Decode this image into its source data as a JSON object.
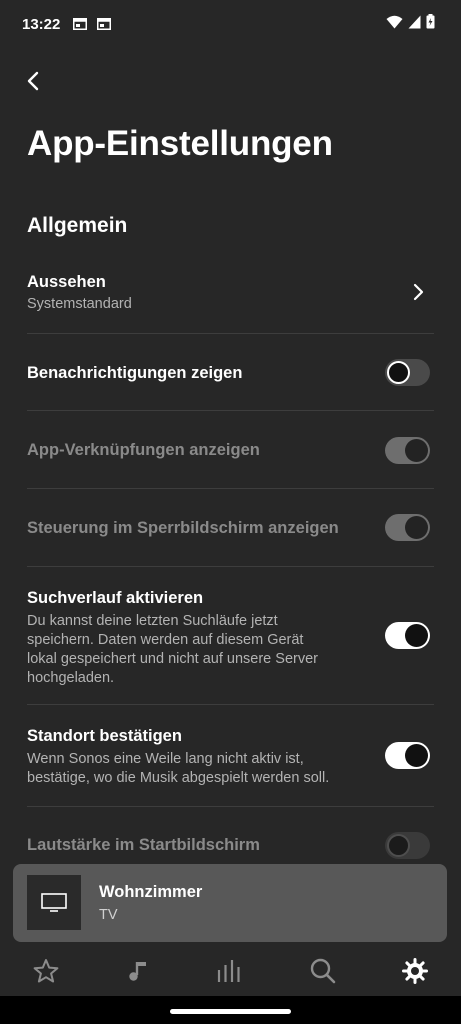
{
  "status_bar": {
    "time": "13:22",
    "notification_icons": [
      "app-notification-icon",
      "app-notification-icon"
    ],
    "system_icons": [
      "wifi-icon",
      "signal-icon",
      "battery-charging-icon"
    ]
  },
  "header": {
    "back_icon": "chevron-left-icon",
    "title": "App-Einstellungen"
  },
  "section": {
    "title": "Allgemein"
  },
  "settings": {
    "appearance": {
      "title": "Aussehen",
      "value": "Systemstandard",
      "icon": "chevron-right-icon"
    },
    "notifications": {
      "title": "Benachrichtigungen zeigen",
      "state": "off",
      "enabled": true
    },
    "app_shortcuts": {
      "title": "App-Verknüpfungen anzeigen",
      "state": "on",
      "enabled": false
    },
    "lockscreen_controls": {
      "title": "Steuerung im Sperrbildschirm anzeigen",
      "state": "on",
      "enabled": false
    },
    "search_history": {
      "title": "Suchverlauf aktivieren",
      "description_lines": [
        "Du kannst deine letzten Suchläufe jetzt",
        "speichern. Daten werden auf diesem Gerät",
        "lokal gespeichert und nicht auf unsere Server",
        "hochgeladen."
      ],
      "state": "on",
      "enabled": true
    },
    "confirm_location": {
      "title": "Standort bestätigen",
      "description_lines": [
        "Wenn Sonos eine Weile lang nicht aktiv ist,",
        "bestätige, wo die Musik abgespielt werden soll."
      ],
      "state": "on",
      "enabled": true
    },
    "homescreen_volume": {
      "title": "Lautstärke im Startbildschirm",
      "state": "off",
      "enabled": false
    }
  },
  "now_playing": {
    "room": "Wohnzimmer",
    "source": "TV",
    "art_icon": "tv-icon"
  },
  "tab_bar": {
    "tabs": [
      {
        "name": "favorites",
        "icon": "star-icon",
        "active": false
      },
      {
        "name": "music",
        "icon": "music-note-icon",
        "active": false
      },
      {
        "name": "rooms",
        "icon": "equalizer-icon",
        "active": false
      },
      {
        "name": "search",
        "icon": "search-icon",
        "active": false
      },
      {
        "name": "settings",
        "icon": "gear-icon",
        "active": true
      }
    ]
  },
  "colors": {
    "background": "#272727",
    "now_playing_bar": "#585858",
    "text_primary": "#ffffff",
    "text_secondary": "#b3b3b3",
    "text_disabled": "#8a8a8a",
    "tab_inactive": "#8c8c8c",
    "tab_active": "#ffffff"
  }
}
